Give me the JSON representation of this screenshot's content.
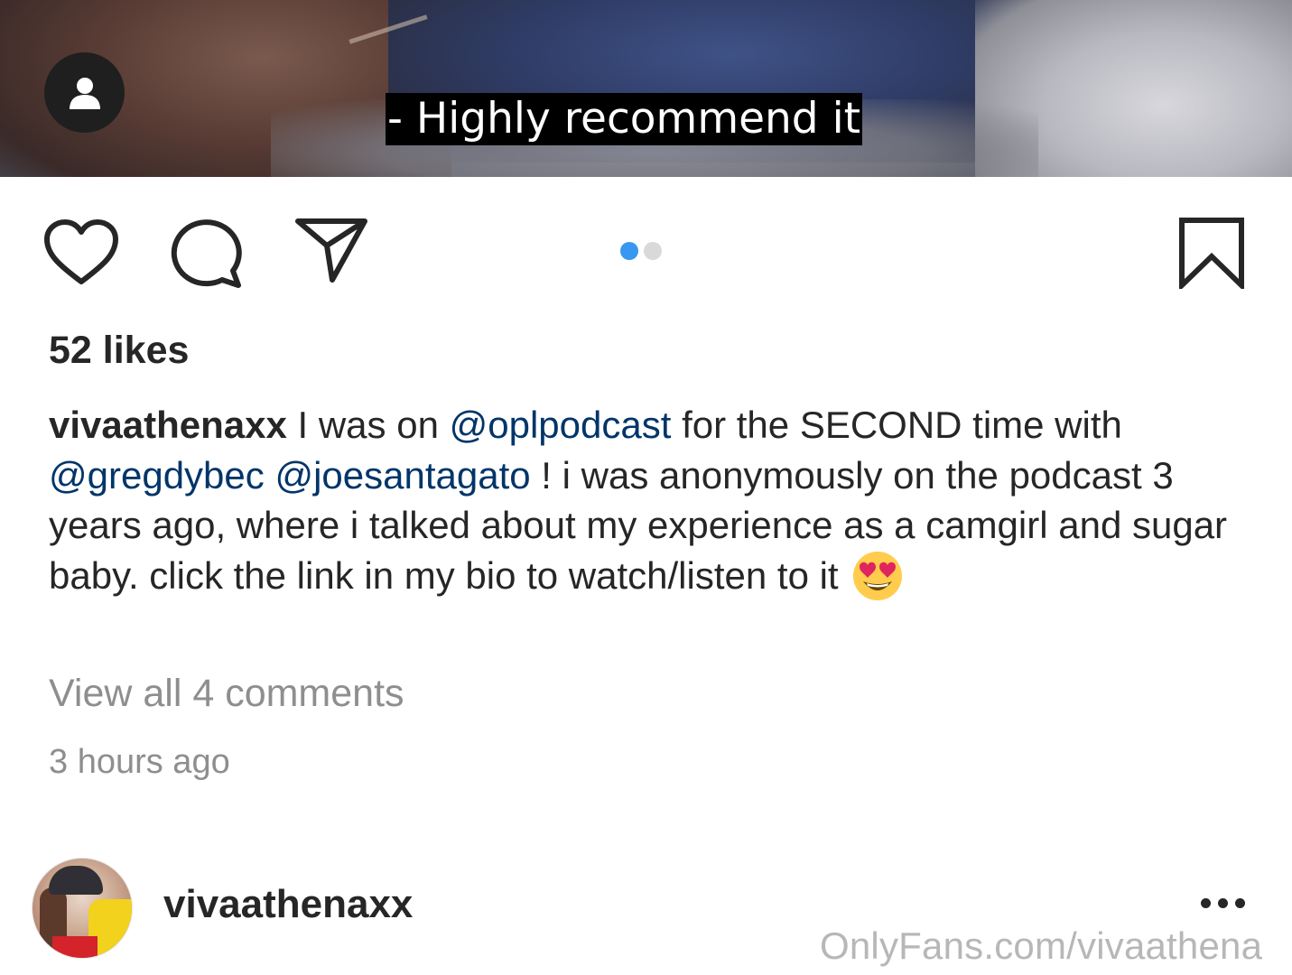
{
  "media": {
    "subtitle": "- Highly recommend it",
    "tag_icon": "user-icon"
  },
  "actions": {
    "like_icon": "heart-icon",
    "comment_icon": "comment-icon",
    "share_icon": "send-icon",
    "save_icon": "bookmark-icon",
    "carousel": {
      "count": 2,
      "active": 1,
      "active_color": "#3897f0",
      "inactive_color": "#d9d9d9"
    }
  },
  "post": {
    "likes": "52 likes",
    "caption": {
      "username": "vivaathenaxx",
      "text_1": " I was on ",
      "mention_1": "@oplpodcast",
      "text_2": " for the SECOND time with ",
      "mention_2": "@gregdybec",
      "text_3": " ",
      "mention_3": "@joesantagato",
      "text_4": " ! i was anonymously on the podcast 3 years ago, where i talked about my experience as a camgirl and sugar baby. click the link in my bio to watch/listen to it",
      "emoji": "heart-eyes-emoji"
    },
    "view_comments": "View all 4 comments",
    "timestamp": "3 hours ago"
  },
  "next_post": {
    "username": "vivaathenaxx",
    "more_icon": "more-options-icon"
  },
  "watermark": "OnlyFans.com/vivaathena",
  "colors": {
    "text": "#262626",
    "mention": "#003569",
    "muted": "#8e8e8e"
  }
}
